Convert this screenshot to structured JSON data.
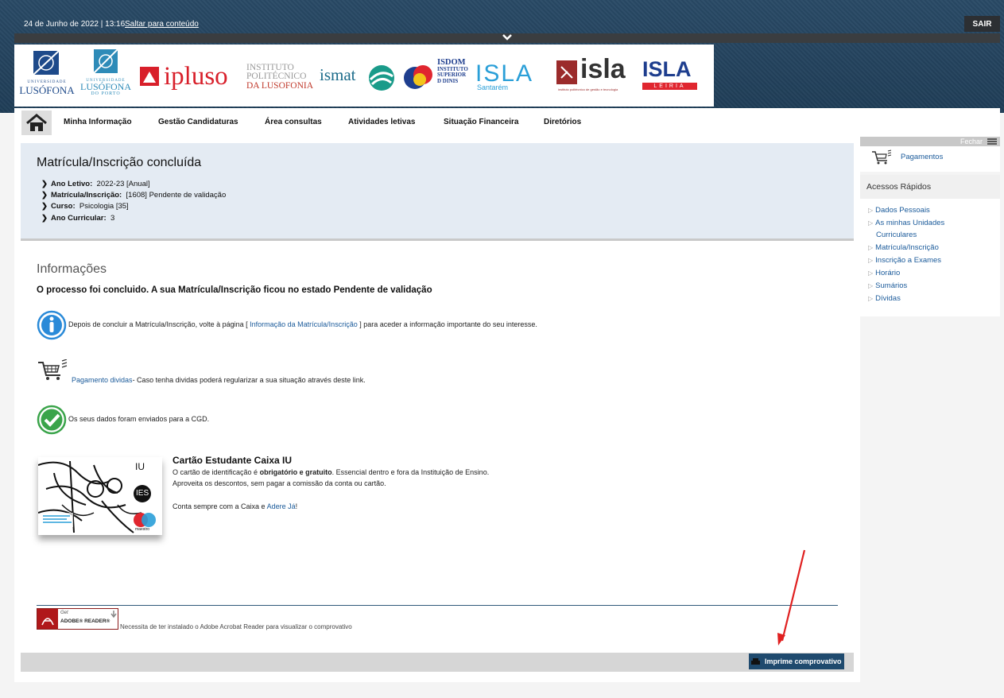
{
  "topbar": {
    "datetime": "24 de Junho de 2022 | 13:16",
    "skip_link": "Saltar para conteúdo",
    "logout": "SAIR"
  },
  "logos": {
    "ulusofona": {
      "line1": "UNIVERSIDADE",
      "line2": "LUSÓFONA"
    },
    "ulusofona_porto": {
      "line1": "UNIVERSIDADE",
      "line2": "LUSÓFONA",
      "line3": "DO PORTO"
    },
    "ipluso": "ipluso",
    "ipl": {
      "line1": "INSTITUTO",
      "line2": "POLITÉCNICO",
      "line3": "DA LUSOFONIA"
    },
    "ismat": "ismat",
    "isdom": {
      "line1": "ISDOM",
      "line2": "INSTITUTO",
      "line3": "SUPERIOR",
      "line4": "D DINIS"
    },
    "isla_santarem": {
      "name": "ISLA",
      "place": "Santarém"
    },
    "isla": {
      "name": "isla",
      "tagline": "instituto politécnico de gestão e tecnologia"
    },
    "isla_leiria": {
      "name": "ISLA",
      "place": "LEIRIA"
    }
  },
  "nav": {
    "items": [
      "Minha Informação",
      "Gestão Candidaturas",
      "Área consultas",
      "Atividades letivas",
      "Situação Financeira",
      "Diretórios"
    ]
  },
  "summary": {
    "title": "Matrícula/Inscrição concluída",
    "rows": [
      {
        "label": "Ano Letivo:",
        "value": "2022-23 [Anual]"
      },
      {
        "label": "Matrícula/Inscrição:",
        "value": "[1608] Pendente de validação"
      },
      {
        "label": "Curso:",
        "value": "Psicologia [35]"
      },
      {
        "label": "Ano Curricular:",
        "value": "3"
      }
    ]
  },
  "info": {
    "heading": "Informações",
    "message": "O processo foi concluido. A sua Matrícula/Inscrição ficou no estado  Pendente de validação",
    "notice_pre": "Depois de concluir a Matrícula/Inscrição, volte à página [",
    "notice_link": "Informação da Matrícula/Inscrição",
    "notice_post": "] para aceder a informação importante do seu interesse.",
    "debt_link": "Pagamento dividas",
    "debt_text": "- Caso tenha dividas poderá regularizar a sua situação através deste link.",
    "cgd_text": "Os seus dados foram enviados para a CGD."
  },
  "card": {
    "title": "Cartão Estudante Caixa IU",
    "line1_pre": "O cartão de identificação é ",
    "line1_bold": "obrigatório e gratuito",
    "line1_post": ". Essencial dentro e fora da Instituição de Ensino.",
    "line2": "Aproveita os descontos, sem pagar a comissão da conta ou cartão.",
    "line3_pre": "Conta sempre com a Caixa e ",
    "line3_link": "Adere Já",
    "line3_post": "!",
    "img_iu": "IU",
    "img_ies": "IES",
    "img_maestro": "maestro"
  },
  "adobe": {
    "get": "Get",
    "reader": "ADOBE® READER®",
    "note": "Necessita de ter instalado o Adobe Acrobat Reader para visualizar o comprovativo"
  },
  "print_button": "Imprime comprovativo",
  "sidebar": {
    "close": "Fechar",
    "payments": "Pagamentos",
    "quick_access_title": "Acessos Rápidos",
    "links": [
      "Dados Pessoais",
      "As minhas Unidades",
      "Curriculares",
      "Matrícula/Inscrição",
      "Inscrição a Exames",
      "Horário",
      "Sumários",
      "Dívidas"
    ]
  },
  "colors": {
    "accent": "#1f4a6e",
    "link": "#1a5a9a",
    "annotation_arrow": "#e02020"
  }
}
